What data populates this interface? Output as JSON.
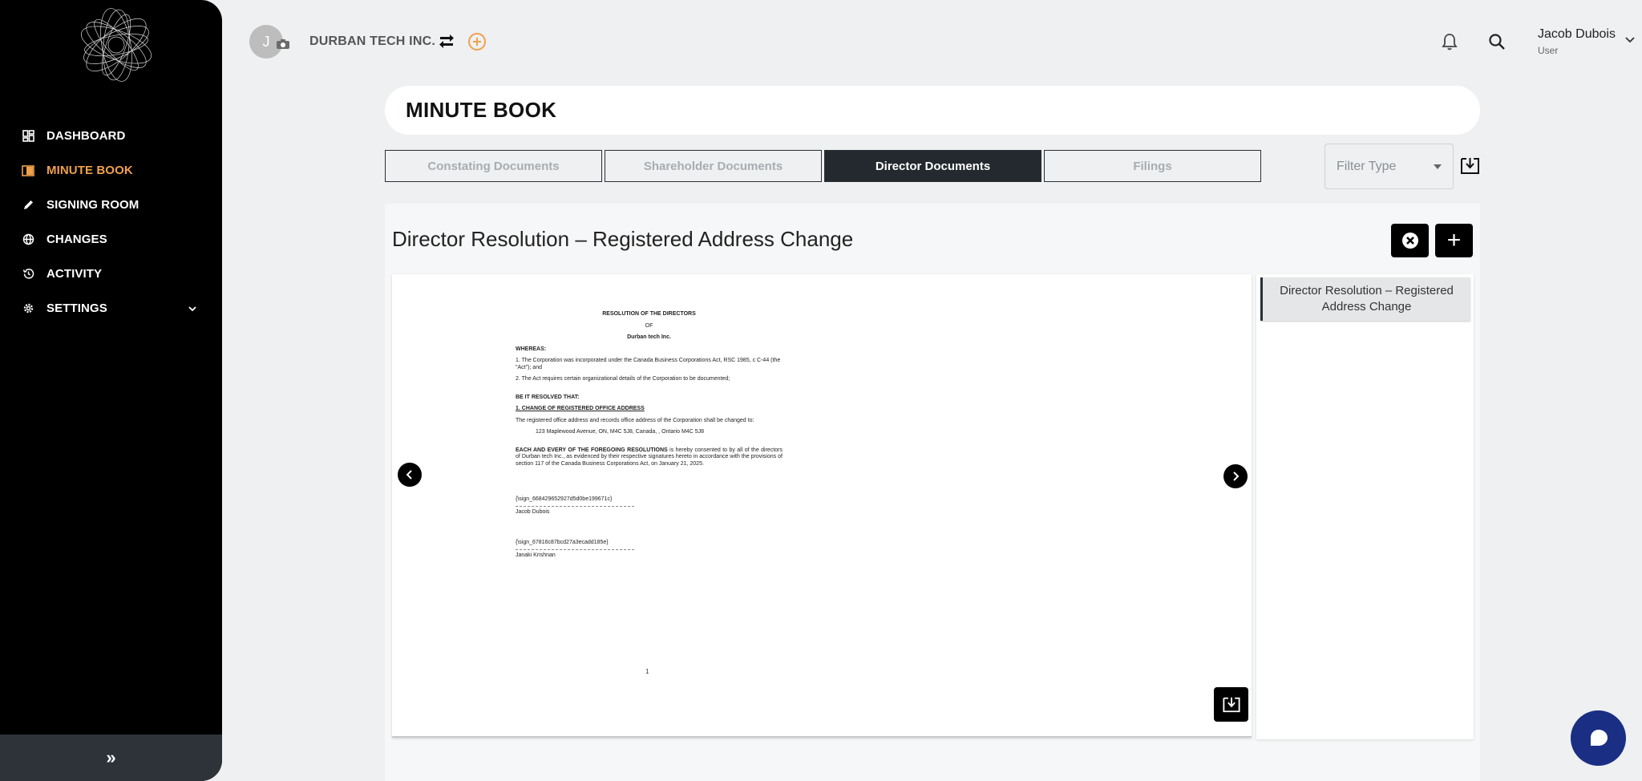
{
  "sidebar": {
    "items": [
      {
        "label": "DASHBOARD",
        "icon": "dashboard-icon"
      },
      {
        "label": "MINUTE BOOK",
        "icon": "book-icon"
      },
      {
        "label": "SIGNING ROOM",
        "icon": "pen-icon"
      },
      {
        "label": "CHANGES",
        "icon": "globe-icon"
      },
      {
        "label": "ACTIVITY",
        "icon": "history-icon"
      },
      {
        "label": "SETTINGS",
        "icon": "gear-icon"
      }
    ],
    "collapse_label": "»"
  },
  "header": {
    "avatar_initial": "J",
    "company": "DURBAN TECH INC.",
    "user_name": "Jacob Dubois",
    "user_role": "User"
  },
  "page_title": "MINUTE BOOK",
  "tabs": [
    {
      "label": "Constating Documents"
    },
    {
      "label": "Shareholder Documents"
    },
    {
      "label": "Director Documents"
    },
    {
      "label": "Filings"
    }
  ],
  "filter": {
    "placeholder": "Filter Type"
  },
  "document": {
    "title": "Director Resolution – Registered Address Change",
    "add_label": "+",
    "page_number": "1",
    "content": {
      "heading1": "RESOLUTION OF THE DIRECTORS",
      "heading2": "OF",
      "heading3": "Durban tech Inc.",
      "whereas": "WHEREAS:",
      "clause1": "1.   The Corporation was incorporated under the Canada Business Corporations Act, RSC 1985, c C-44 (the \"Act\"); and",
      "clause2": "2.   The Act requires certain organizational details of the Corporation to be documented;",
      "resolved": "BE IT RESOLVED THAT:",
      "section_title": "1.        CHANGE OF REGISTERED OFFICE ADDRESS",
      "section_body": "The registered office address and records office address of the Corporation shall be changed to:",
      "address": "123 Maplewood Avenue, ON, M4C 5J8, Canada,  , Ontario M4C 5J8",
      "closing_bold": "EACH AND EVERY OF THE FOREGOING RESOLUTIONS",
      "closing_rest": " is hereby consented to by all of the directors of Durban tech Inc., as evidenced by their respective signatures hereto in accordance with the provisions of section 117 of the Canada Business Corporations Act, on January 21, 2025.",
      "sig1_tag": "{\\sign_668429652927d5d0be199671c}",
      "sig1_name": "Jacob Dubois",
      "sig2_tag": "{\\sign_67816c87bcd27a3ecadd185e}",
      "sig2_name": "Janaki Krishnan"
    }
  },
  "doc_list": [
    {
      "label": "Director Resolution – Registered Address Change"
    }
  ],
  "colors": {
    "accent": "#f0a04b",
    "sidebar_bg": "#000000",
    "active_tab": "#24292f",
    "chat": "#1a2e83"
  }
}
